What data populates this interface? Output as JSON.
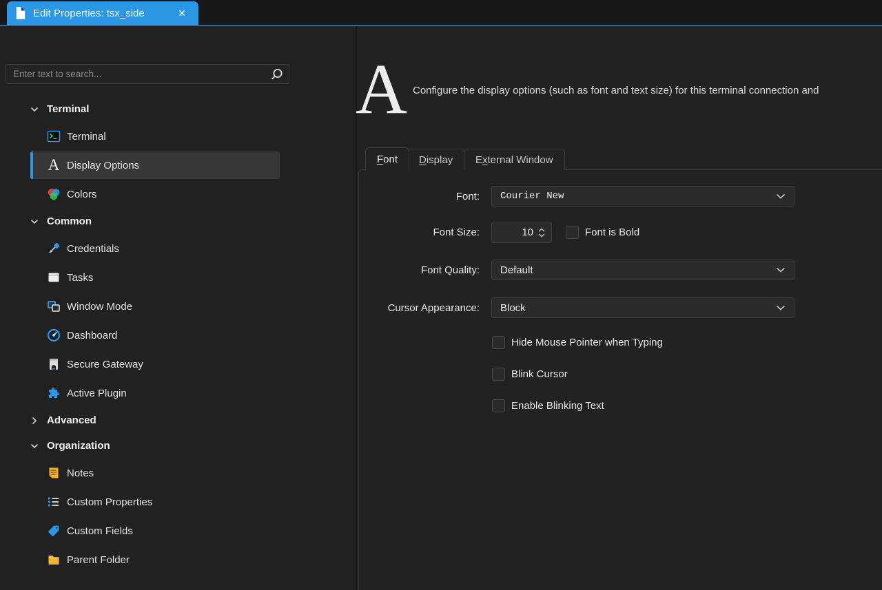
{
  "titlebar": {
    "tab_title": "Edit Properties: tsx_side",
    "close_glyph": "✕"
  },
  "glyphs": {
    "letter_a": "A"
  },
  "sidebar": {
    "search": {
      "placeholder": "Enter text to search..."
    },
    "tree": [
      {
        "type": "group",
        "label": "Terminal",
        "expanded": true
      },
      {
        "type": "item",
        "label": "Terminal",
        "icon": "terminal-icon"
      },
      {
        "type": "item",
        "label": "Display Options",
        "icon": "letter-a-icon",
        "selected": true
      },
      {
        "type": "item",
        "label": "Colors",
        "icon": "colors-icon"
      },
      {
        "type": "group",
        "label": "Common",
        "expanded": true
      },
      {
        "type": "item",
        "label": "Credentials",
        "icon": "key-icon"
      },
      {
        "type": "item",
        "label": "Tasks",
        "icon": "tasks-icon"
      },
      {
        "type": "item",
        "label": "Window Mode",
        "icon": "window-mode-icon"
      },
      {
        "type": "item",
        "label": "Dashboard",
        "icon": "dashboard-icon"
      },
      {
        "type": "item",
        "label": "Secure Gateway",
        "icon": "secure-gateway-icon"
      },
      {
        "type": "item",
        "label": "Active Plugin",
        "icon": "puzzle-icon"
      },
      {
        "type": "group",
        "label": "Advanced",
        "expanded": false
      },
      {
        "type": "group",
        "label": "Organization",
        "expanded": true
      },
      {
        "type": "item",
        "label": "Notes",
        "icon": "notes-icon"
      },
      {
        "type": "item",
        "label": "Custom Properties",
        "icon": "list-icon"
      },
      {
        "type": "item",
        "label": "Custom Fields",
        "icon": "tag-icon"
      },
      {
        "type": "item",
        "label": "Parent Folder",
        "icon": "folder-icon"
      }
    ]
  },
  "main": {
    "header": {
      "description": "Configure the display options (such as font and text size) for this terminal connection and"
    },
    "tabs": [
      {
        "pre": "",
        "key": "F",
        "rest": "ont",
        "active": true
      },
      {
        "pre": "",
        "key": "D",
        "rest": "isplay",
        "active": false
      },
      {
        "pre": "E",
        "key": "x",
        "rest": "ternal Window",
        "active": false
      }
    ],
    "form": {
      "font_label": "Font:",
      "font_value": "Courier New",
      "font_size_label": "Font Size:",
      "font_size_value": "10",
      "font_bold_label": "Font is Bold",
      "font_bold_checked": false,
      "font_quality_label": "Font Quality:",
      "font_quality_value": "Default",
      "cursor_label": "Cursor Appearance:",
      "cursor_value": "Block",
      "option_checkboxes": [
        {
          "label": "Hide Mouse Pointer when Typing",
          "checked": false
        },
        {
          "label": "Blink Cursor",
          "checked": false
        },
        {
          "label": "Enable Blinking Text",
          "checked": false
        }
      ]
    }
  },
  "colors": {
    "accent_blue": "#2b97e5",
    "tab_underline_blue": "#2b6ea4",
    "background": "#212121",
    "selected_row_bg": "#373737",
    "notes_yellow": "#f3b52b"
  }
}
